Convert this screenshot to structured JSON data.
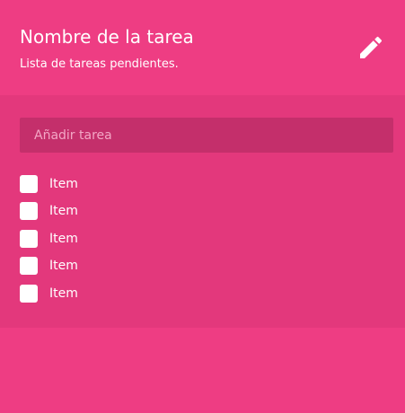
{
  "header": {
    "title": "Nombre de la tarea",
    "subtitle": "Lista de tareas pendientes.",
    "edit_icon": "pencil-icon"
  },
  "add_task": {
    "placeholder": "Añadir tarea",
    "value": ""
  },
  "tasks": [
    {
      "label": "Item",
      "checked": false
    },
    {
      "label": "Item",
      "checked": false
    },
    {
      "label": "Item",
      "checked": false
    },
    {
      "label": "Item",
      "checked": false
    },
    {
      "label": "Item",
      "checked": false
    }
  ],
  "colors": {
    "accent": "#ee3d83",
    "panel": "#e3387c",
    "input_bg": "#c42f6b",
    "text": "#ffffff"
  }
}
